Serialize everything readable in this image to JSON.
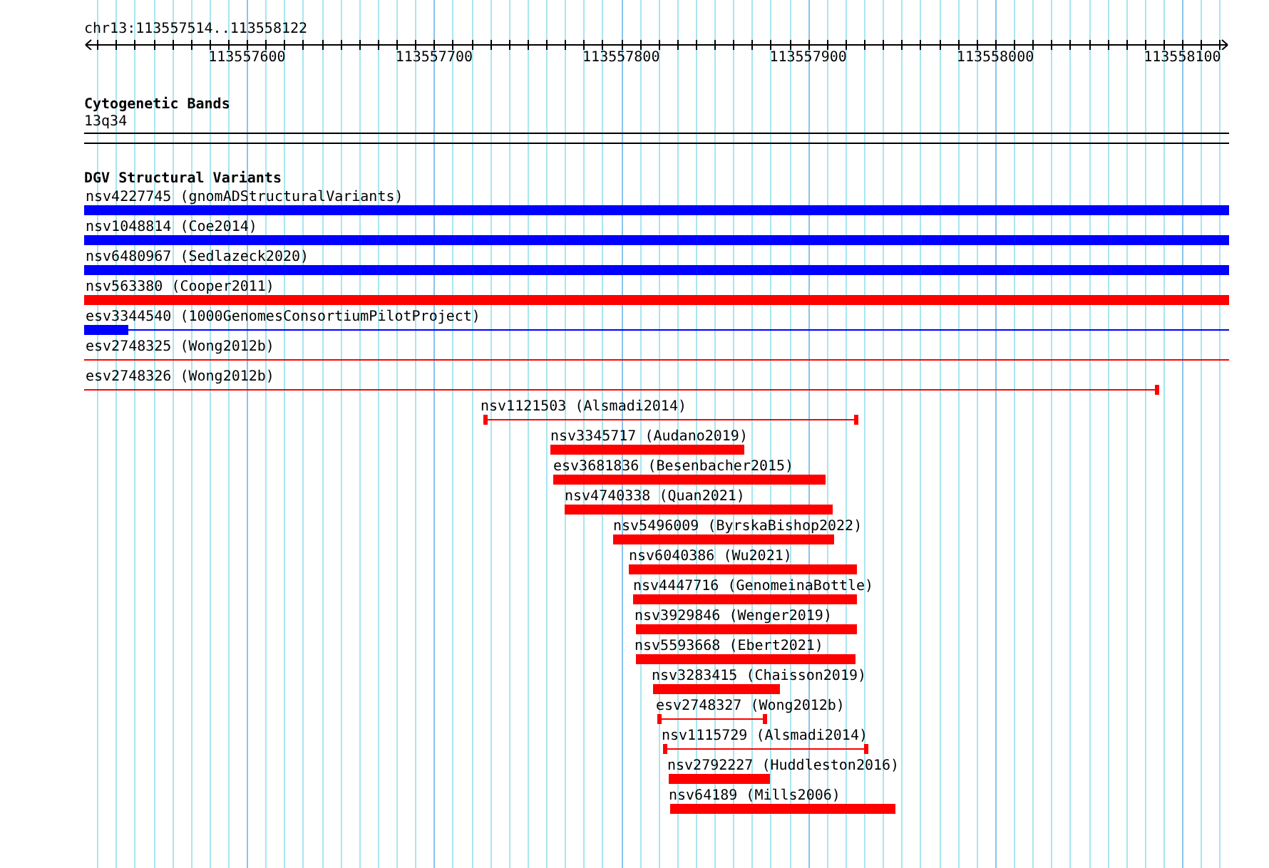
{
  "ruler": {
    "location": "chr13:113557514..113558122",
    "tick_labels": [
      "113557600",
      "113557700",
      "113557800",
      "113557900",
      "113558000",
      "113558100"
    ]
  },
  "cytogenetic_bands": {
    "title": "Cytogenetic Bands",
    "band": "13q34"
  },
  "dgv_structural_variants": {
    "title": "DGV Structural Variants",
    "features": [
      {
        "label": "nsv4227745 (gnomADStructuralVariants)",
        "color": "#0000ff",
        "kind": "bar"
      },
      {
        "label": "nsv1048814 (Coe2014)",
        "color": "#0000ff",
        "kind": "bar"
      },
      {
        "label": "nsv6480967 (Sedlazeck2020)",
        "color": "#0000ff",
        "kind": "bar"
      },
      {
        "label": "nsv563380 (Cooper2011)",
        "color": "#ff0000",
        "kind": "bar"
      },
      {
        "label": "esv3344540 (1000GenomesConsortiumPilotProject)",
        "color": "#0000ff",
        "kind": "bar-line"
      },
      {
        "label": "esv2748325 (Wong2012b)",
        "color": "#ff0000",
        "kind": "line"
      },
      {
        "label": "esv2748326 (Wong2012b)",
        "color": "#ff0000",
        "kind": "line"
      },
      {
        "label": "nsv1121503 (Alsmadi2014)",
        "color": "#ff0000",
        "kind": "line"
      },
      {
        "label": "nsv3345717 (Audano2019)",
        "color": "#ff0000",
        "kind": "bar"
      },
      {
        "label": "esv3681836 (Besenbacher2015)",
        "color": "#ff0000",
        "kind": "bar"
      },
      {
        "label": "nsv4740338 (Quan2021)",
        "color": "#ff0000",
        "kind": "bar"
      },
      {
        "label": "nsv5496009 (ByrskaBishop2022)",
        "color": "#ff0000",
        "kind": "bar"
      },
      {
        "label": "nsv6040386 (Wu2021)",
        "color": "#ff0000",
        "kind": "bar"
      },
      {
        "label": "nsv4447716 (GenomeinaBottle)",
        "color": "#ff0000",
        "kind": "bar"
      },
      {
        "label": "nsv3929846 (Wenger2019)",
        "color": "#ff0000",
        "kind": "bar"
      },
      {
        "label": "nsv5593668 (Ebert2021)",
        "color": "#ff0000",
        "kind": "bar"
      },
      {
        "label": "nsv3283415 (Chaisson2019)",
        "color": "#ff0000",
        "kind": "bar"
      },
      {
        "label": "esv2748327 (Wong2012b)",
        "color": "#ff0000",
        "kind": "line"
      },
      {
        "label": "nsv1115729 (Alsmadi2014)",
        "color": "#ff0000",
        "kind": "line"
      },
      {
        "label": "nsv2792227 (Huddleston2016)",
        "color": "#ff0000",
        "kind": "bar"
      },
      {
        "label": "nsv64189 (Mills2006)",
        "color": "#ff0000",
        "kind": "bar"
      }
    ]
  }
}
